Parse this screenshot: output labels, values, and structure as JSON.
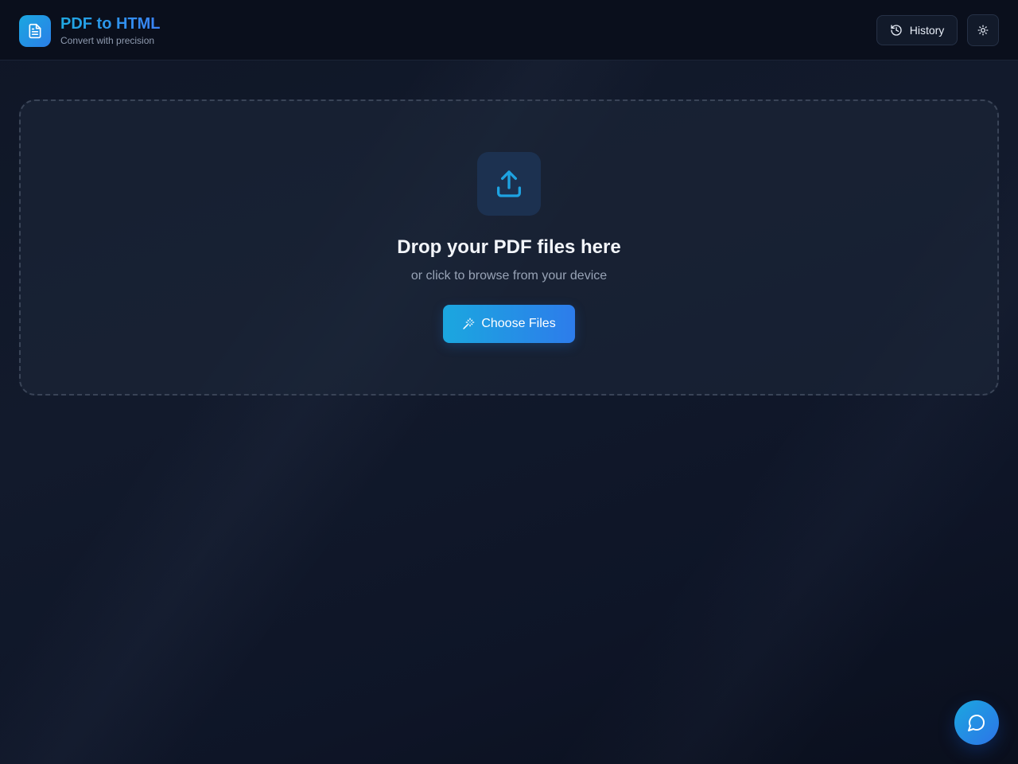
{
  "header": {
    "title": "PDF to HTML",
    "subtitle": "Convert with precision",
    "logo_icon": "file-text-icon",
    "history_label": "History",
    "history_icon": "history-icon",
    "theme_icon": "sun-icon"
  },
  "dropzone": {
    "icon": "upload-icon",
    "title": "Drop your PDF files here",
    "subtitle": "or click to browse from your device",
    "button_label": "Choose Files",
    "button_icon": "sparkles-icon"
  },
  "chat": {
    "icon": "message-circle-icon"
  },
  "colors": {
    "accent_start": "#1ba7df",
    "accent_end": "#2d7ceb",
    "background": "#0f1626",
    "header_bg": "#0a0f1c"
  }
}
